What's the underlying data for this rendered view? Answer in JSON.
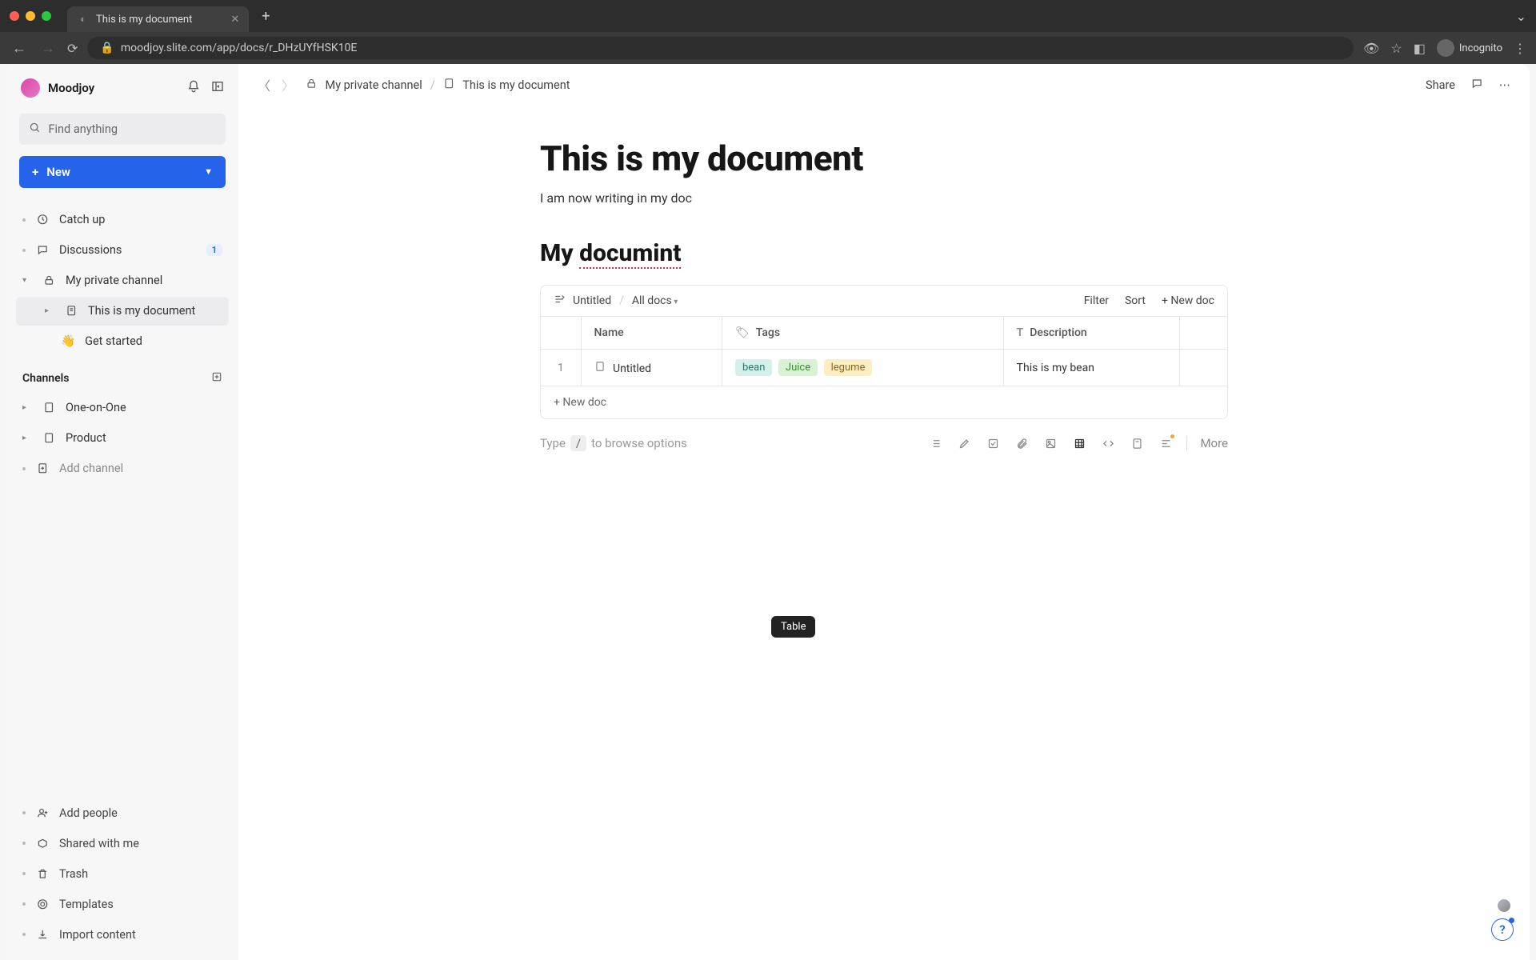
{
  "browser": {
    "tab_title": "This is my document",
    "url": "moodjoy.slite.com/app/docs/r_DHzUYfHSK10E",
    "incognito_label": "Incognito"
  },
  "workspace": {
    "name": "Moodjoy"
  },
  "sidebar": {
    "search_placeholder": "Find anything",
    "new_label": "New",
    "items": {
      "catchup": "Catch up",
      "discussions": "Discussions",
      "discussions_badge": "1",
      "private_channel": "My private channel",
      "this_doc": "This is my document",
      "get_started": "Get started"
    },
    "channels_title": "Channels",
    "channels": {
      "one_on_one": "One-on-One",
      "product": "Product",
      "add_channel": "Add channel"
    },
    "footer": {
      "add_people": "Add people",
      "shared": "Shared with me",
      "trash": "Trash",
      "templates": "Templates",
      "import": "Import content"
    }
  },
  "breadcrumb": {
    "parent": "My private channel",
    "current": "This is my document"
  },
  "topbar": {
    "share": "Share"
  },
  "doc": {
    "title": "This is my document",
    "subtitle": "I am now writing in my doc",
    "heading_prefix": "My ",
    "heading_misspelled": "documint"
  },
  "table": {
    "view_name": "Untitled",
    "scope": "All docs",
    "filter": "Filter",
    "sort": "Sort",
    "new_doc": "New doc",
    "columns": {
      "name": "Name",
      "tags": "Tags",
      "description": "Description"
    },
    "rows": [
      {
        "idx": "1",
        "name": "Untitled",
        "tags": [
          "bean",
          "Juice",
          "legume"
        ],
        "description": "This is my bean"
      }
    ],
    "add_row": "New doc"
  },
  "tooltip": {
    "table": "Table"
  },
  "editor_hint": {
    "prefix": "Type",
    "key": "/",
    "suffix": "to browse options",
    "more": "More"
  }
}
